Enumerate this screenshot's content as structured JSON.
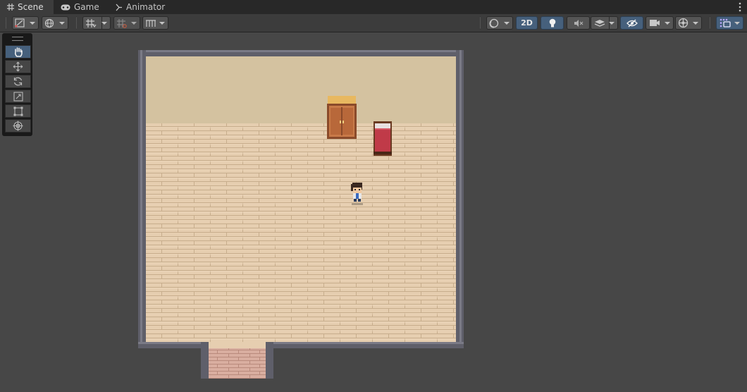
{
  "tabs": [
    {
      "label": "Scene",
      "icon": "grid-icon",
      "active": true
    },
    {
      "label": "Game",
      "icon": "gamepad-icon",
      "active": false
    },
    {
      "label": "Animator",
      "icon": "animator-icon",
      "active": false
    }
  ],
  "toolbar": {
    "mode_2d_label": "2D"
  },
  "tools": [
    {
      "name": "hand-tool",
      "icon": "hand-icon",
      "selected": true
    },
    {
      "name": "move-tool",
      "icon": "move-icon",
      "selected": false
    },
    {
      "name": "rotate-tool",
      "icon": "rotate-icon",
      "selected": false
    },
    {
      "name": "scale-tool",
      "icon": "scale-icon",
      "selected": false
    },
    {
      "name": "rect-tool",
      "icon": "rect-icon",
      "selected": false
    },
    {
      "name": "transform-tool",
      "icon": "transform-icon",
      "selected": false
    }
  ],
  "colors": {
    "accent": "#46607c",
    "panel": "#3c3c3c",
    "background": "#474747",
    "wall": "#60606b",
    "floor": "#e6ceb0",
    "upper_wall": "#d4c2a0",
    "bed": "#c03a48"
  }
}
